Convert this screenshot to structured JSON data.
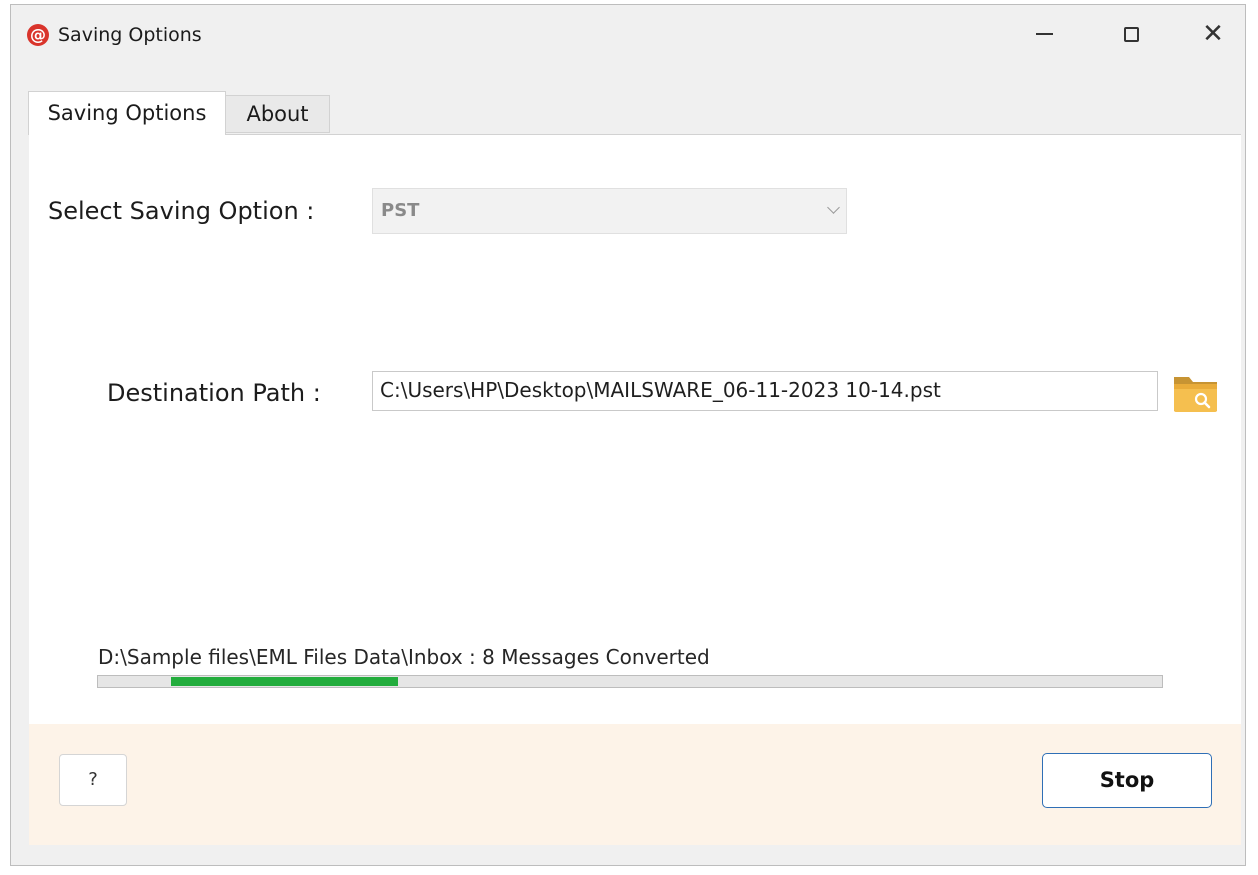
{
  "window": {
    "title": "Saving Options",
    "app_icon_glyph": "@",
    "controls": {
      "minimize": "minimize-icon",
      "maximize": "maximize-icon",
      "close": "close-icon"
    }
  },
  "tabs": [
    {
      "label": "Saving Options",
      "active": true
    },
    {
      "label": "About",
      "active": false
    }
  ],
  "form": {
    "saving_option_label": "Select Saving Option :",
    "saving_option_value": "PST",
    "destination_label": "Destination Path :",
    "destination_value": "C:\\Users\\HP\\Desktop\\MAILSWARE_06-11-2023 10-14.pst",
    "browse_icon": "folder-search-icon"
  },
  "progress": {
    "status_text": "D:\\Sample files\\EML Files Data\\Inbox : 8 Messages Converted",
    "fill_color": "#23ad3d"
  },
  "footer": {
    "help_label": "?",
    "stop_label": "Stop"
  },
  "colors": {
    "app_icon": "#d9342b",
    "footer_bg": "#fdf3e8",
    "stop_border": "#2f6fb6"
  }
}
